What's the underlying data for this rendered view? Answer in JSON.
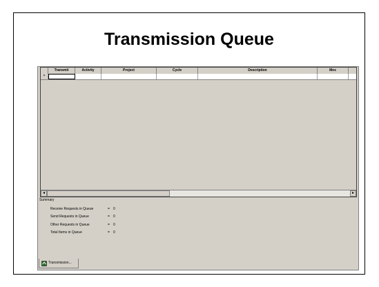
{
  "slide": {
    "title": "Transmission Queue"
  },
  "grid": {
    "columns": [
      "",
      "Transmit",
      "Activity",
      "Project",
      "Cycle",
      "Description",
      "Mes"
    ],
    "new_row_marker": "*"
  },
  "scrollbar": {
    "left_arrow": "◂",
    "right_arrow": "▸"
  },
  "summary": {
    "heading": "Summary",
    "items": [
      {
        "label": "Receive Requests in Queue",
        "eq": "=",
        "value": "0"
      },
      {
        "label": "Send Requests in Queue",
        "eq": "=",
        "value": "0"
      },
      {
        "label": "Other Requests in Queue",
        "eq": "=",
        "value": "0"
      },
      {
        "label": "Total Items in Queue",
        "eq": "=",
        "value": "0"
      }
    ]
  },
  "tab": {
    "label": "Transmission...",
    "icon": "transmission-icon"
  },
  "colors": {
    "window_bg": "#d4d0c8",
    "border": "#808080"
  }
}
